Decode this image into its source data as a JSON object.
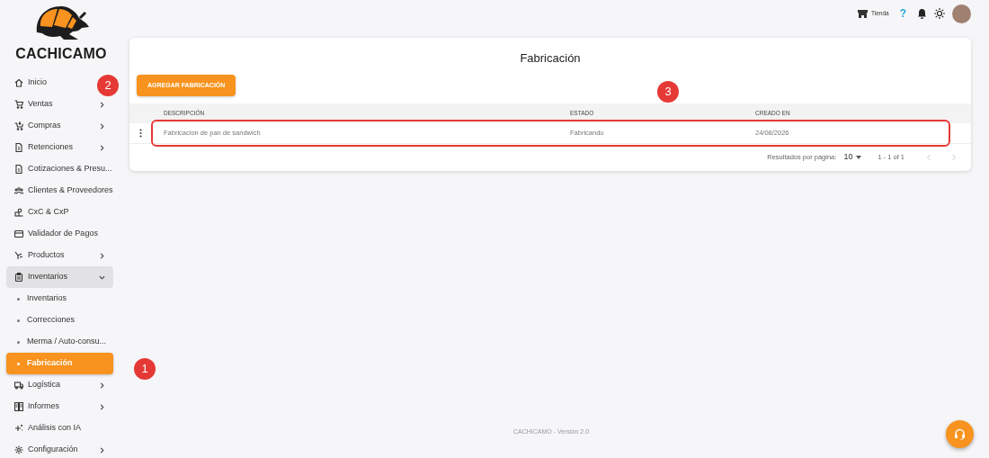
{
  "brand": {
    "name": "CACHICAMO"
  },
  "sidebar": {
    "items": [
      {
        "label": "Inicio",
        "kind": "link",
        "selected": false
      },
      {
        "label": "Ventas",
        "kind": "group",
        "expanded": false,
        "selected": false
      },
      {
        "label": "Compras",
        "kind": "group",
        "expanded": false,
        "selected": false
      },
      {
        "label": "Retenciones",
        "kind": "group",
        "expanded": false,
        "selected": false
      },
      {
        "label": "Cotizaciones & Presu...",
        "kind": "link",
        "selected": false
      },
      {
        "label": "Clientes & Proveedores",
        "kind": "link",
        "selected": false
      },
      {
        "label": "CxC & CxP",
        "kind": "link",
        "selected": false
      },
      {
        "label": "Validador de Pagos",
        "kind": "link",
        "selected": false
      },
      {
        "label": "Productos",
        "kind": "group",
        "expanded": false,
        "selected": false
      },
      {
        "label": "Inventarios",
        "kind": "group",
        "expanded": true,
        "selected": false,
        "children": [
          {
            "label": "Inventarios",
            "selected": false
          },
          {
            "label": "Correcciones",
            "selected": false
          },
          {
            "label": "Merma / Auto-consu...",
            "selected": false
          },
          {
            "label": "Fabricación",
            "selected": true
          }
        ]
      },
      {
        "label": "Logística",
        "kind": "group",
        "expanded": false,
        "selected": false
      },
      {
        "label": "Informes",
        "kind": "group",
        "expanded": false,
        "selected": false
      },
      {
        "label": "Análisis con IA",
        "kind": "link",
        "selected": false
      },
      {
        "label": "Configuración",
        "kind": "group",
        "expanded": false,
        "selected": false
      }
    ]
  },
  "topbar": {
    "store_label": "Tienda",
    "help": "?"
  },
  "page": {
    "title": "Fabricación",
    "add_button": "AGREGAR FABRICACIÓN"
  },
  "table": {
    "columns": [
      "DESCRIPCIÓN",
      "ESTADO",
      "CREADO EN"
    ],
    "rows": [
      {
        "cells": [
          "Fabricacion de pan de sandwich",
          "Fabricando",
          "24/08/2026"
        ],
        "highlighted": true
      }
    ]
  },
  "pagination": {
    "label": "Resultados por página:",
    "per_page": "10",
    "range": "1 - 1 of 1"
  },
  "annotations": [
    {
      "label": "1"
    },
    {
      "label": "2"
    },
    {
      "label": "3"
    }
  ],
  "footer": {
    "text": "CACHICAMO - Versión 2.0"
  }
}
